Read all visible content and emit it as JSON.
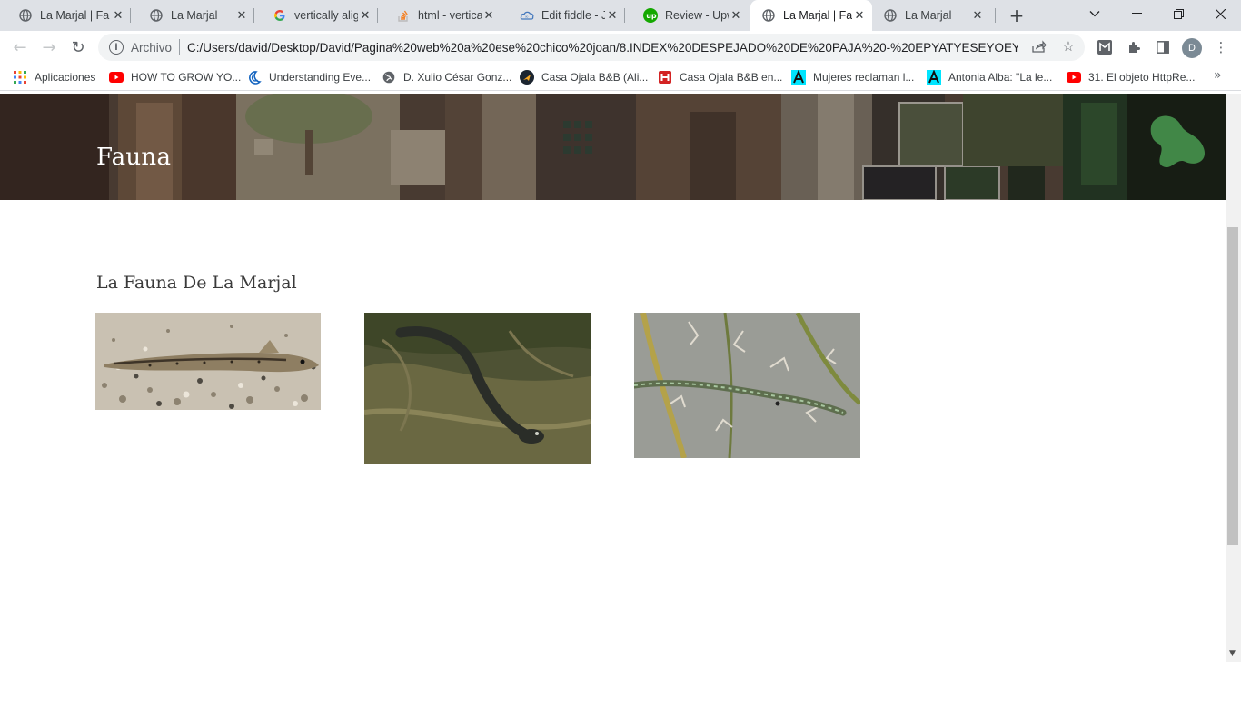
{
  "browser": {
    "tabs": [
      {
        "title": "La Marjal | Fa",
        "icon": "globe-icon",
        "active": false
      },
      {
        "title": "La Marjal",
        "icon": "globe-icon",
        "active": false
      },
      {
        "title": "vertically alig",
        "icon": "google-icon",
        "active": false
      },
      {
        "title": "html - vertica",
        "icon": "stackoverflow-icon",
        "active": false
      },
      {
        "title": "Edit fiddle - J",
        "icon": "jsfiddle-icon",
        "active": false
      },
      {
        "title": "Review - Upw",
        "icon": "upwork-icon",
        "active": false
      },
      {
        "title": "La Marjal | Fa",
        "icon": "globe-icon",
        "active": true
      },
      {
        "title": "La Marjal",
        "icon": "globe-icon",
        "active": false
      }
    ],
    "address": {
      "scheme_label": "Archivo",
      "url": "C:/Users/david/Desktop/David/Pagina%20web%20a%20ese%20chico%20joan/8.INDEX%20DESPEJADO%20DE%20PAJA%20-%20EPYATYESEYOEYO..."
    },
    "profile_initial": "D",
    "bookmarks": [
      {
        "label": "Aplicaciones",
        "icon": "apps-grid-icon"
      },
      {
        "label": "HOW TO GROW YO...",
        "icon": "youtube-icon"
      },
      {
        "label": "Understanding Eve...",
        "icon": "moon-icon"
      },
      {
        "label": "D. Xulio César Gonz...",
        "icon": "globe-icon"
      },
      {
        "label": "Casa Ojala B&B (Ali...",
        "icon": "plane-icon"
      },
      {
        "label": "Casa Ojala B&B en...",
        "icon": "hotel-icon"
      },
      {
        "label": "Mujeres reclaman l...",
        "icon": "a-letter-icon"
      },
      {
        "label": "Antonia Alba: \"La le...",
        "icon": "a-letter-icon"
      },
      {
        "label": "31. El objeto HttpRe...",
        "icon": "youtube-icon"
      }
    ]
  },
  "page": {
    "hero_title": "Fauna",
    "section_title": "La Fauna De La Marjal",
    "photos": [
      {
        "name": "loach-fish-photo"
      },
      {
        "name": "eel-photo"
      },
      {
        "name": "pipefish-photo"
      }
    ]
  },
  "colors": {
    "tabstrip": "#dee1e6",
    "accent_youtube": "#ff0000",
    "accent_upwork": "#14a800"
  }
}
